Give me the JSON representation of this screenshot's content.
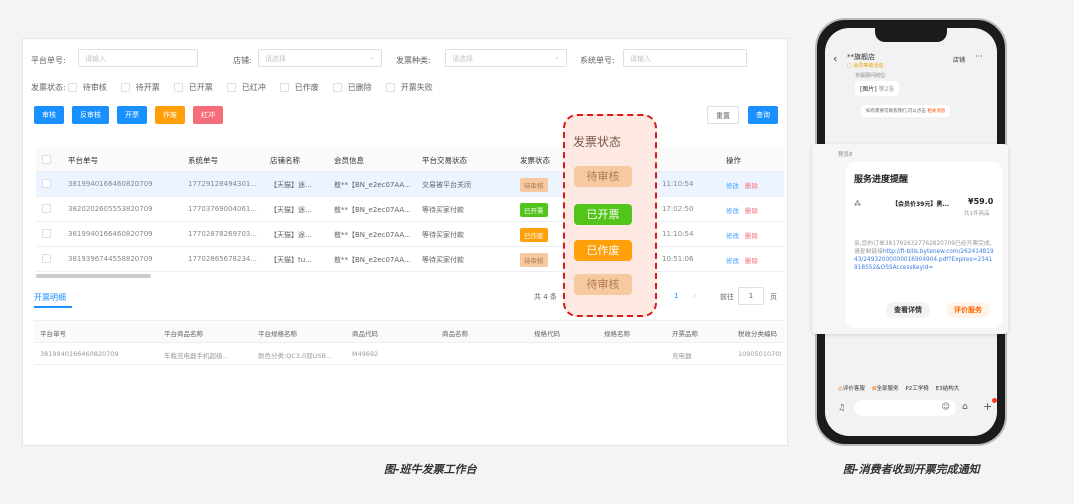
{
  "filters": {
    "platform_order_label": "平台单号:",
    "platform_order_placeholder": "请输入",
    "shop_label": "店铺:",
    "shop_placeholder": "请选择",
    "invoice_type_label": "发票种类:",
    "invoice_type_placeholder": "请选择",
    "system_order_label": "系统单号:",
    "system_order_placeholder": "请输入",
    "status_label": "发票状态:",
    "statuses": [
      "待审核",
      "待开票",
      "已开票",
      "已红冲",
      "已作废",
      "已删除",
      "开票失败"
    ]
  },
  "actions": {
    "audit": "审核",
    "unaudit": "反审核",
    "issue": "开票",
    "void": "作废",
    "red": "红冲",
    "reset": "重置",
    "search": "查询"
  },
  "table": {
    "headers": [
      "平台单号",
      "系统单号",
      "店铺名称",
      "会员信息",
      "平台交易状态",
      "发票状态",
      "操作"
    ],
    "rows": [
      {
        "platform": "3819940166460820709",
        "system": "17729128494301...",
        "shop": "【天猫】途...",
        "member": "敖**【BN_e2ec07AA...",
        "trade": "交易被平台关闭",
        "status": "待审核",
        "time": "11:10:54",
        "edit": "修改",
        "del": "删除"
      },
      {
        "platform": "3820202605553820709",
        "system": "17703769004061...",
        "shop": "【天猫】途...",
        "member": "敖**【BN_e2ec07AA...",
        "trade": "等待买家付款",
        "status": "已开票",
        "time": "17:02:50",
        "edit": "修改",
        "del": "删除"
      },
      {
        "platform": "3819940166460820709",
        "system": "17702878269703...",
        "shop": "【天猫】途...",
        "member": "敖**【BN_e2ec07AA...",
        "trade": "等待买家付款",
        "status": "已作废",
        "time": "11:10:54",
        "edit": "修改",
        "del": "删除"
      },
      {
        "platform": "3819396744558820709",
        "system": "17702865678234...",
        "shop": "【天猫】tu...",
        "member": "敖**【BN_e2ec07AA...",
        "trade": "等待买家付款",
        "status": "待审核",
        "time": "10:51:06",
        "edit": "修改",
        "del": "删除"
      }
    ]
  },
  "pagination": {
    "total": "共 4 条",
    "page": "1",
    "goto_label": "前往",
    "goto_value": "1",
    "page_suffix": "页"
  },
  "detail": {
    "tab": "开票明细",
    "headers": [
      "平台单号",
      "平台商品名称",
      "平台规格名称",
      "商品代码",
      "商品名称",
      "规格代码",
      "规格名称",
      "开票品称",
      "税收分类编码"
    ],
    "row": [
      "3819940166460820709",
      "车载充电器手机超级...",
      "颜色分类:QC3.0双USB...",
      "M49692",
      "",
      "",
      "",
      "充电器",
      "1090501070("
    ]
  },
  "overlay": {
    "header": "发票状态",
    "badges": [
      "待审核",
      "已开票",
      "已作废",
      "待审核"
    ]
  },
  "colors": {
    "primary": "#1890ff",
    "orange": "#ff9f0a",
    "red": "#f56c7b",
    "green": "#52c41a",
    "pending": "#f7c9a0"
  },
  "phone": {
    "shop_name": "**旗舰店",
    "shop_sub": "□ 会员等级活动",
    "shop_btn": "店铺",
    "chat_hint": "专属顾问岗位:",
    "image_msg": "[图片]",
    "image_count": "等2张",
    "notice": "如有需要可联系我们,可以点击",
    "notice_link": "相关消息",
    "sender": "预览8",
    "card_title": "服务进度提醒",
    "product": "【会员价39元】黑...",
    "price": "¥59.0",
    "qty": "共1件商品",
    "message": "亲,您的订单3817926327762820709已经开票完成,请复制链接",
    "link": "http://fi-bills.bytenew.com/26241481943/2493200000001690490​4.pdf?Expires=2341918552&OSSAccessKeyId=",
    "btn_detail": "查看详情",
    "btn_rate": "评价服务",
    "quick": [
      "评价客服",
      "全部服务",
      "P2工学椅",
      "E3结构大"
    ]
  },
  "captions": {
    "left": "图-班牛发票工作台",
    "right": "图-消费者收到开票完成通知"
  }
}
